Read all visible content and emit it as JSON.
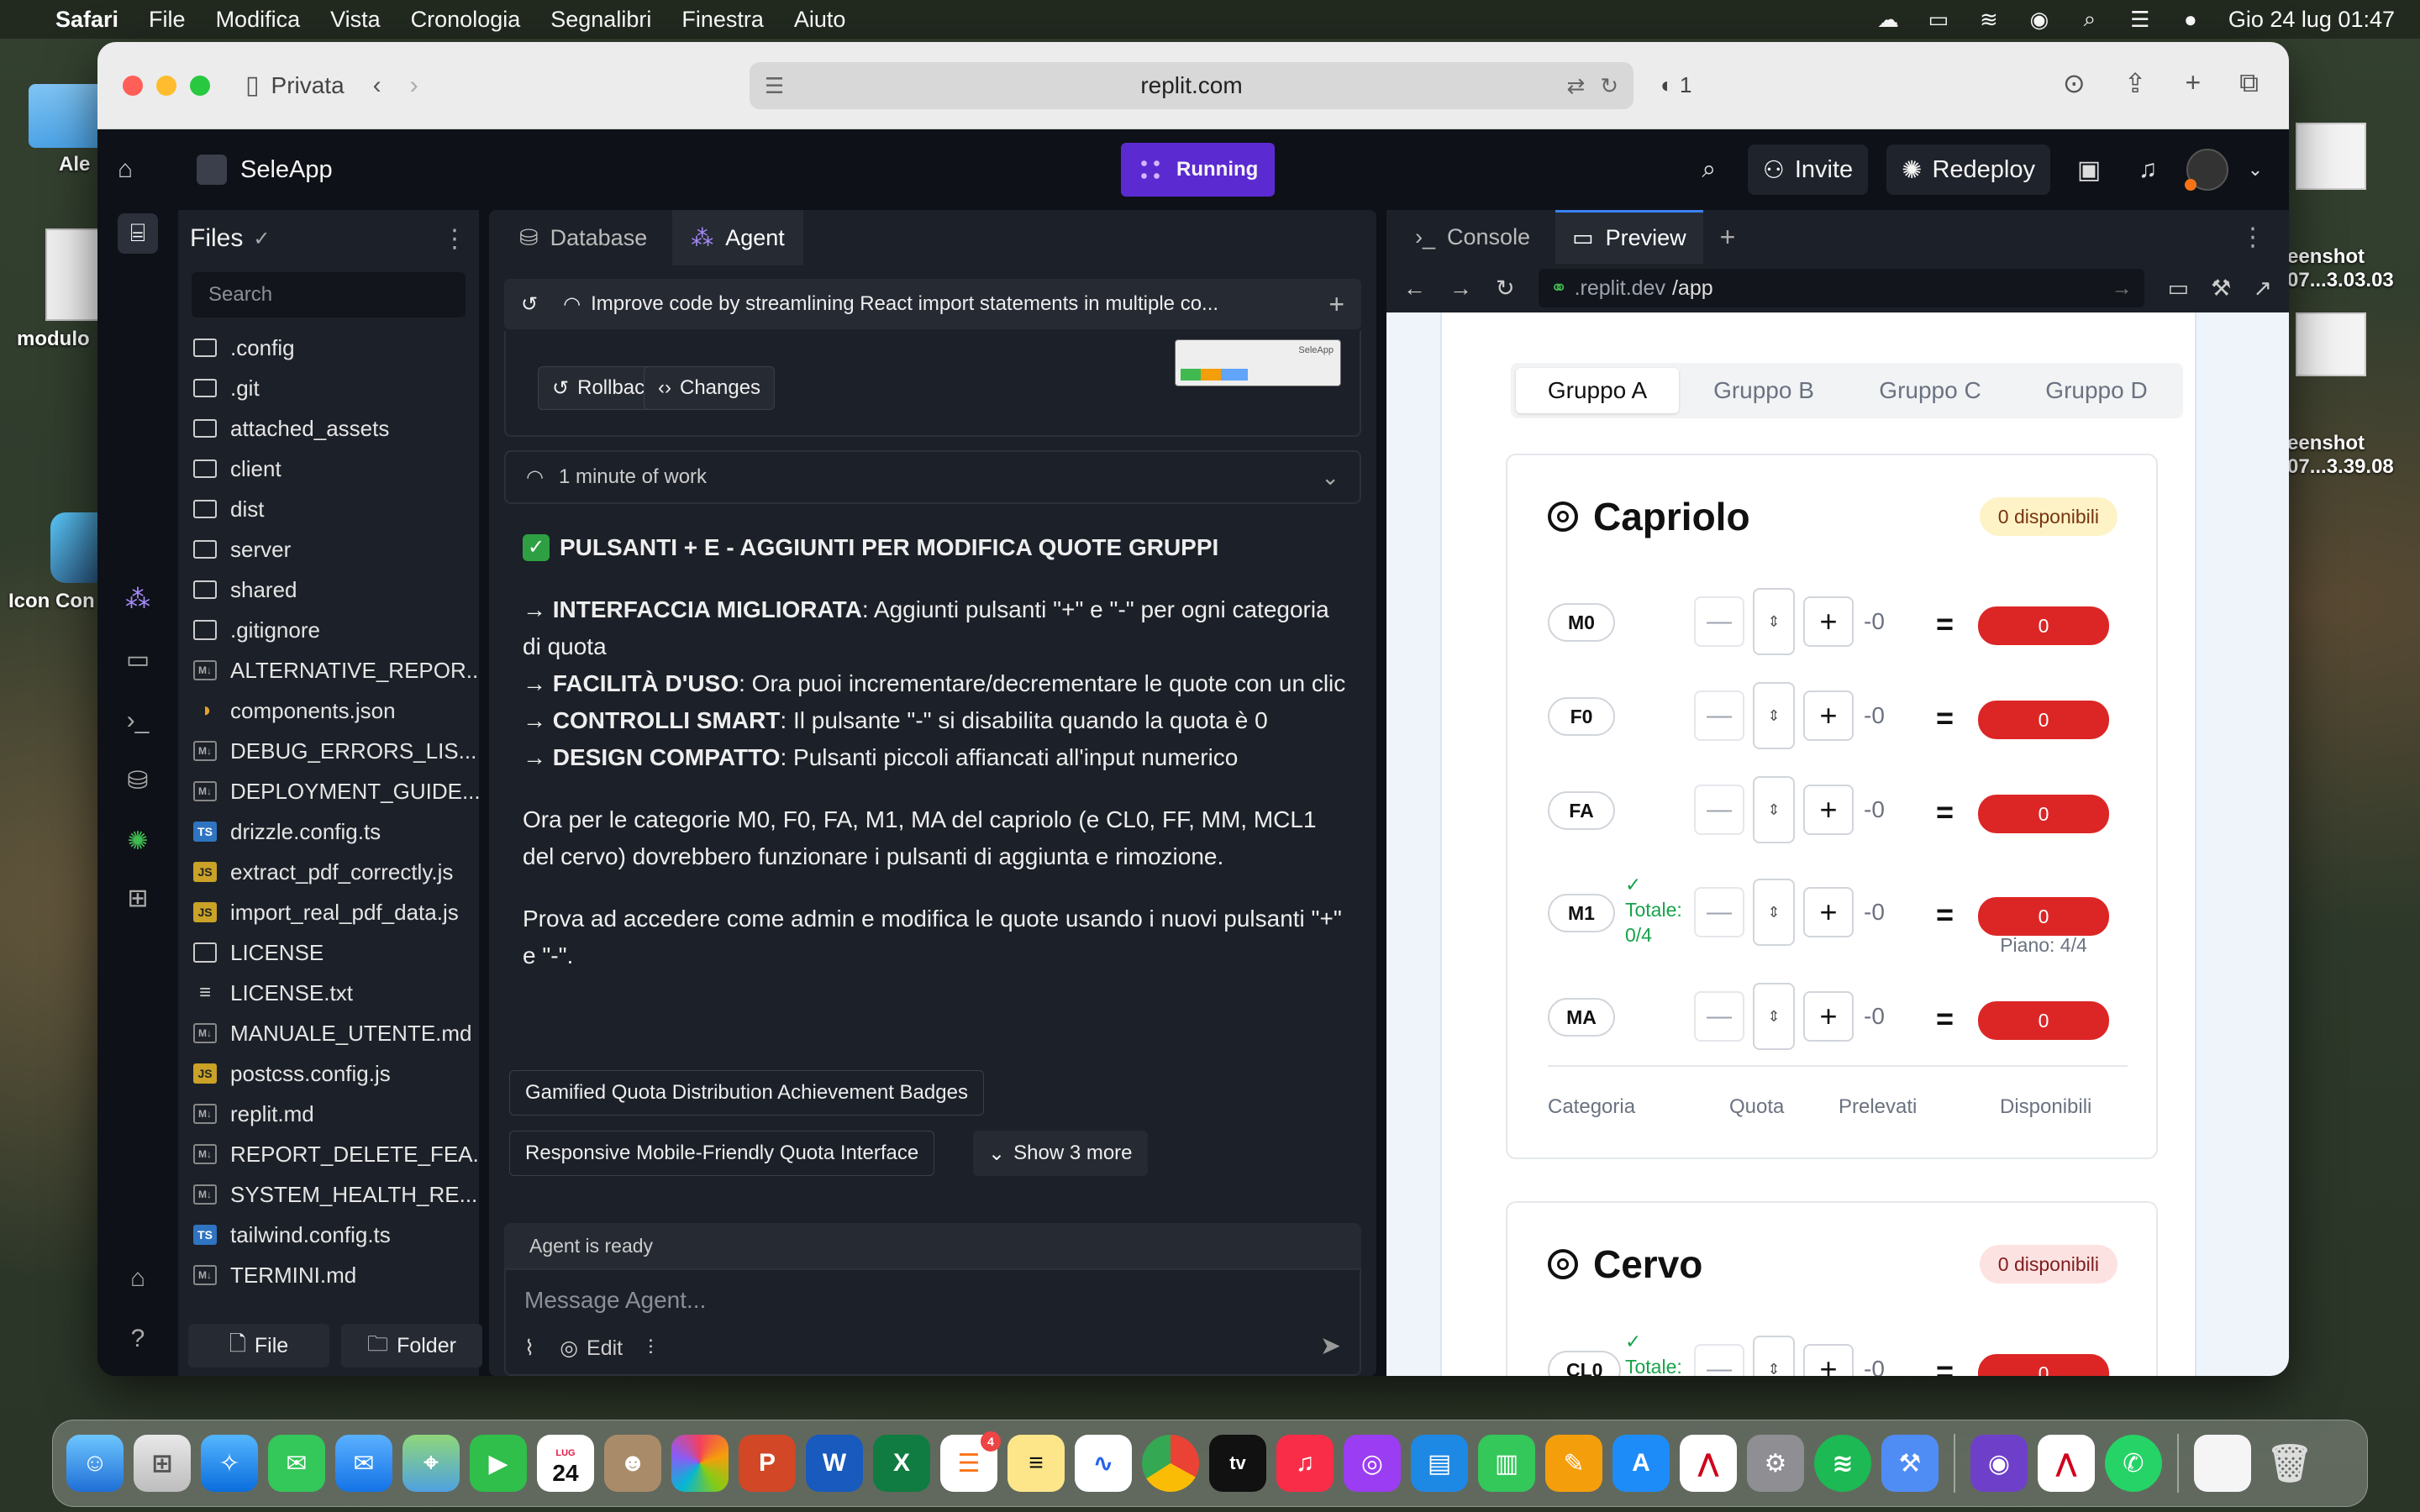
{
  "menubar": {
    "app": "Safari",
    "items": [
      "File",
      "Modifica",
      "Vista",
      "Cronologia",
      "Segnalibri",
      "Finestra",
      "Aiuto"
    ],
    "clock": "Gio 24 lug  01:47"
  },
  "desktop": {
    "left_labels": [
      "Ale",
      "modulo",
      "Icon Con"
    ],
    "right_labels": [
      "eenshot\n07...3.03.03",
      "eenshot\n07...3.39.08"
    ]
  },
  "safari": {
    "private_label": "Privata",
    "url": "replit.com",
    "shield_count": "1"
  },
  "replit": {
    "app_name": "SeleApp",
    "running_label": "Running",
    "invite_label": "Invite",
    "redeploy_label": "Redeploy",
    "files": {
      "title": "Files",
      "search_placeholder": "Search",
      "items": [
        {
          "name": ".config",
          "type": "folder"
        },
        {
          "name": ".git",
          "type": "folder"
        },
        {
          "name": "attached_assets",
          "type": "folder"
        },
        {
          "name": "client",
          "type": "folder"
        },
        {
          "name": "dist",
          "type": "folder"
        },
        {
          "name": "server",
          "type": "folder"
        },
        {
          "name": "shared",
          "type": "folder"
        },
        {
          "name": ".gitignore",
          "type": "doc"
        },
        {
          "name": "ALTERNATIVE_REPOR...",
          "type": "md"
        },
        {
          "name": "components.json",
          "type": "json"
        },
        {
          "name": "DEBUG_ERRORS_LIS...",
          "type": "md"
        },
        {
          "name": "DEPLOYMENT_GUIDE....",
          "type": "md"
        },
        {
          "name": "drizzle.config.ts",
          "type": "ts"
        },
        {
          "name": "extract_pdf_correctly.js",
          "type": "js"
        },
        {
          "name": "import_real_pdf_data.js",
          "type": "js"
        },
        {
          "name": "LICENSE",
          "type": "doc"
        },
        {
          "name": "LICENSE.txt",
          "type": "txt"
        },
        {
          "name": "MANUALE_UTENTE.md",
          "type": "md"
        },
        {
          "name": "postcss.config.js",
          "type": "js"
        },
        {
          "name": "replit.md",
          "type": "md"
        },
        {
          "name": "REPORT_DELETE_FEA...",
          "type": "md"
        },
        {
          "name": "SYSTEM_HEALTH_RE...",
          "type": "md"
        },
        {
          "name": "tailwind.config.ts",
          "type": "ts"
        },
        {
          "name": "TERMINI.md",
          "type": "md"
        }
      ],
      "new_file_label": "File",
      "new_folder_label": "Folder"
    },
    "agent": {
      "tab_database": "Database",
      "tab_agent": "Agent",
      "thread_title": "Improve code by streamlining React import statements in multiple co...",
      "rollback_label": "Rollback here",
      "changes_label": "Changes",
      "thumb_label": "SeleApp",
      "work_label": "1 minute of work",
      "heading": "PULSANTI + E - AGGIUNTI PER MODIFICA QUOTE GRUPPI",
      "bullets": [
        {
          "bold": "→ INTERFACCIA MIGLIORATA",
          "text": ": Aggiunti pulsanti \"+\" e \"-\" per ogni categoria di quota"
        },
        {
          "bold": "→ FACILITÀ D'USO",
          "text": ": Ora puoi incrementare/decrementare le quote con un clic"
        },
        {
          "bold": "→ CONTROLLI SMART",
          "text": ": Il pulsante \"-\" si disabilita quando la quota è 0"
        },
        {
          "bold": "→ DESIGN COMPATTO",
          "text": ": Pulsanti piccoli affiancati all'input numerico"
        }
      ],
      "para1": "Ora per le categorie M0, F0, FA, M1, MA del capriolo (e CL0, FF, MM, MCL1 del cervo) dovrebbero funzionare i pulsanti di aggiunta e rimozione.",
      "para2": "Prova ad accedere come admin e modifica le quote usando i nuovi pulsanti \"+\" e \"-\".",
      "suggestion1": "Gamified Quota Distribution Achievement Badges",
      "suggestion2": "Responsive Mobile-Friendly Quota Interface",
      "show_more": "Show 3 more",
      "status": "Agent is ready",
      "input_placeholder": "Message Agent...",
      "edit_label": "Edit"
    },
    "right_panel": {
      "tab_console": "Console",
      "tab_preview": "Preview",
      "url_host": ".replit.dev",
      "url_path": "/app"
    }
  },
  "preview": {
    "groups": [
      "Gruppo A",
      "Gruppo B",
      "Gruppo C",
      "Gruppo D"
    ],
    "cards": [
      {
        "title": "Capriolo",
        "badge": "0 disponibili",
        "rows": [
          {
            "cat": "M0",
            "value": "-0",
            "disp": "0"
          },
          {
            "cat": "F0",
            "value": "-0",
            "disp": "0"
          },
          {
            "cat": "FA",
            "value": "-0",
            "disp": "0"
          },
          {
            "cat": "M1",
            "value": "-0",
            "disp": "0",
            "totale": "✓\nTotale:\n0/4",
            "piano": "Piano: 4/4"
          },
          {
            "cat": "MA",
            "value": "-0",
            "disp": "0"
          }
        ],
        "footer": [
          "Categoria",
          "Quota",
          "Prelevati",
          "Disponibili"
        ]
      },
      {
        "title": "Cervo",
        "badge": "0 disponibili",
        "rows": [
          {
            "cat": "CL0",
            "value": "-0",
            "disp": "0",
            "totale": "✓\nTotale:"
          }
        ]
      }
    ]
  },
  "dock": {
    "calendar_month": "LUG",
    "calendar_day": "24",
    "reminders_badge": "4",
    "tv_label": "tv"
  }
}
